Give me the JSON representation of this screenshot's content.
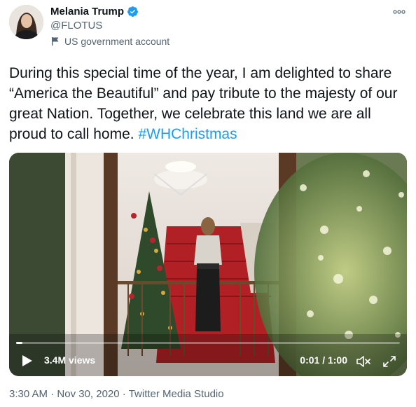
{
  "author": {
    "display_name": "Melania Trump",
    "handle": "@FLOTUS",
    "verified": true,
    "label": "US government account"
  },
  "tweet": {
    "text": "During this special time of the year, I am delighted to share “America the Beautiful” and pay tribute to the majesty of our great Nation. Together, we celebrate this land we are all proud to call home. ",
    "hashtag": "#WHChristmas"
  },
  "video": {
    "views": "3.4M views",
    "time": "0:01 / 1:00",
    "progress": 0.0167
  },
  "meta": {
    "time": "3:30 AM",
    "separator1": " · ",
    "date": "Nov 30, 2020",
    "separator2": " · ",
    "source": "Twitter Media Studio"
  },
  "colors": {
    "link": "#1d9bf0",
    "secondary_text": "#536471"
  }
}
